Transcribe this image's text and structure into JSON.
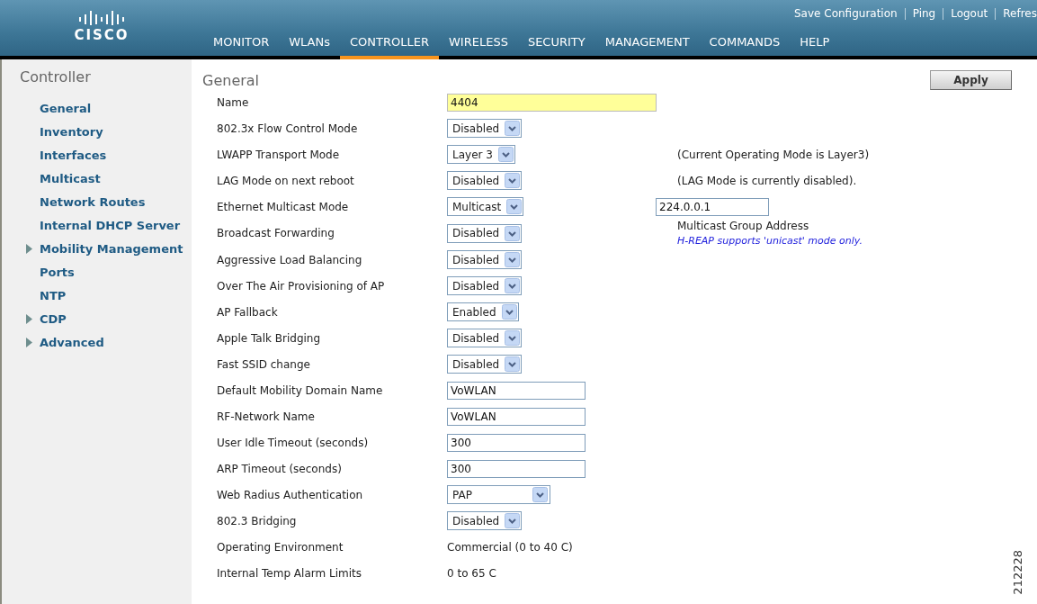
{
  "header": {
    "logo_text": "CISCO",
    "top_links": [
      "Save Configuration",
      "Ping",
      "Logout",
      "Refres"
    ],
    "tabs": [
      {
        "label": "MONITOR",
        "selected": false
      },
      {
        "label": "WLANs",
        "selected": false
      },
      {
        "label": "CONTROLLER",
        "selected": true
      },
      {
        "label": "WIRELESS",
        "selected": false
      },
      {
        "label": "SECURITY",
        "selected": false
      },
      {
        "label": "MANAGEMENT",
        "selected": false
      },
      {
        "label": "COMMANDS",
        "selected": false
      },
      {
        "label": "HELP",
        "selected": false
      }
    ]
  },
  "sidebar": {
    "title": "Controller",
    "items": [
      {
        "label": "General",
        "kind": "link"
      },
      {
        "label": "Inventory",
        "kind": "link"
      },
      {
        "label": "Interfaces",
        "kind": "link"
      },
      {
        "label": "Multicast",
        "kind": "link"
      },
      {
        "label": "Network Routes",
        "kind": "link"
      },
      {
        "label": "Internal DHCP Server",
        "kind": "link"
      },
      {
        "label": "Mobility Management",
        "kind": "group"
      },
      {
        "label": "Ports",
        "kind": "link"
      },
      {
        "label": "NTP",
        "kind": "link"
      },
      {
        "label": "CDP",
        "kind": "group"
      },
      {
        "label": "Advanced",
        "kind": "group"
      }
    ]
  },
  "page": {
    "title": "General",
    "apply_button": "Apply",
    "fields": [
      {
        "label": "Name",
        "kind": "text",
        "value": "4404",
        "highlighted": true
      },
      {
        "label": "802.3x Flow Control Mode",
        "kind": "select",
        "value": "Disabled"
      },
      {
        "label": "LWAPP Transport Mode",
        "kind": "select",
        "value": "Layer 3",
        "notes": [
          {
            "kind": "text",
            "text": "(Current Operating Mode is Layer3)"
          }
        ]
      },
      {
        "label": "LAG Mode on next reboot",
        "kind": "select",
        "value": "Disabled",
        "notes": [
          {
            "kind": "text",
            "text": "(LAG Mode is currently disabled)."
          }
        ]
      },
      {
        "label": "Ethernet Multicast Mode",
        "kind": "select",
        "value": "Multicast",
        "notes": [
          {
            "kind": "field",
            "text": "224.0.0.1"
          }
        ]
      },
      {
        "label": "Broadcast Forwarding",
        "kind": "select",
        "value": "Disabled",
        "notes": [
          {
            "kind": "text",
            "text": "Multicast Group Address"
          },
          {
            "kind": "hint",
            "text": "H-REAP supports 'unicast' mode only."
          }
        ]
      },
      {
        "label": "Aggressive Load Balancing",
        "kind": "select",
        "value": "Disabled"
      },
      {
        "label": "Over The Air Provisioning of AP",
        "kind": "select",
        "value": "Disabled"
      },
      {
        "label": "AP Fallback",
        "kind": "select",
        "value": "Enabled"
      },
      {
        "label": "Apple Talk Bridging",
        "kind": "select",
        "value": "Disabled"
      },
      {
        "label": "Fast SSID change",
        "kind": "select",
        "value": "Disabled"
      },
      {
        "label": "Default Mobility Domain Name",
        "kind": "text",
        "value": "VoWLAN",
        "highlighted": false
      },
      {
        "label": "RF-Network Name",
        "kind": "text",
        "value": "VoWLAN",
        "highlighted": false
      },
      {
        "label": "User Idle Timeout (seconds)",
        "kind": "text",
        "value": "300",
        "highlighted": false
      },
      {
        "label": "ARP Timeout (seconds)",
        "kind": "text",
        "value": "300",
        "highlighted": false
      },
      {
        "label": "Web Radius Authentication",
        "kind": "select-wide",
        "value": "PAP"
      },
      {
        "label": "802.3 Bridging",
        "kind": "select",
        "value": "Disabled"
      },
      {
        "label": "Operating Environment",
        "kind": "static",
        "value": "Commercial (0 to 40 C)"
      },
      {
        "label": "Internal Temp Alarm Limits",
        "kind": "static",
        "value": "0 to 65 C"
      }
    ]
  },
  "figure_number": "212228"
}
